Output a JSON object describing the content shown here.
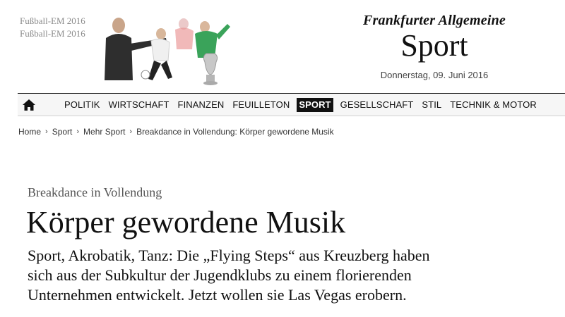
{
  "promo": {
    "label_line1": "Fußball-EM 2016",
    "label_line2": "Fußball-EM 2016"
  },
  "masthead": {
    "brand": "Frankfurter Allgemeine",
    "section": "Sport",
    "date": "Donnerstag, 09. Juni 2016"
  },
  "nav": {
    "home_icon": "home-icon",
    "items": [
      {
        "label": "POLITIK"
      },
      {
        "label": "WIRTSCHAFT"
      },
      {
        "label": "FINANZEN"
      },
      {
        "label": "FEUILLETON"
      },
      {
        "label": "SPORT",
        "active": true
      },
      {
        "label": "GESELLSCHAFT"
      },
      {
        "label": "STIL"
      },
      {
        "label": "TECHNIK & MOTOR"
      }
    ]
  },
  "breadcrumb": [
    "Home",
    "Sport",
    "Mehr Sport",
    "Breakdance in Vollendung: Körper gewordene Musik"
  ],
  "article": {
    "kicker": "Breakdance in Vollendung",
    "headline": "Körper gewordene Musik",
    "teaser_lines": [
      "Sport, Akrobatik, Tanz: Die „Flying Steps“ aus Kreuzberg haben",
      "sich aus der Subkultur der Jugendklubs zu einem florierenden",
      "Unternehmen entwickelt. Jetzt wollen sie Las Vegas erobern."
    ],
    "byline_prefix": "",
    "byline_author": ""
  },
  "colors": {
    "nav_active_bg": "#111111",
    "text": "#111111",
    "kicker": "#555555",
    "author": "#cc3333"
  }
}
